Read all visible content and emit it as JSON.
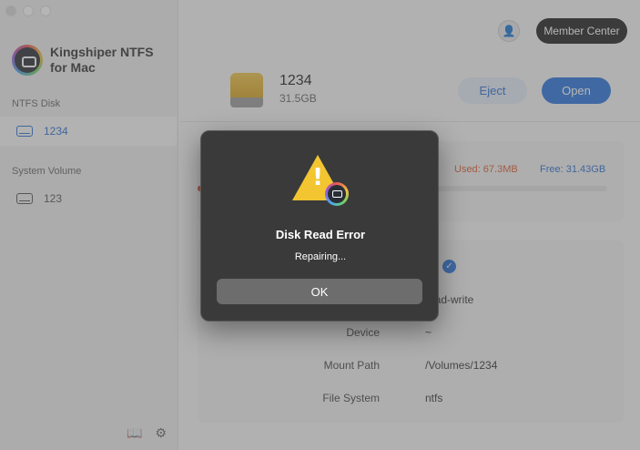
{
  "app": {
    "name": "Kingshiper NTFS for Mac"
  },
  "sidebar": {
    "ntfs_label": "NTFS Disk",
    "ntfs_items": [
      {
        "label": "1234"
      }
    ],
    "system_label": "System Volume",
    "system_items": [
      {
        "label": "123"
      }
    ]
  },
  "header": {
    "member_label": "Member Center"
  },
  "drive": {
    "name": "1234",
    "size": "31.5GB",
    "eject_label": "Eject",
    "open_label": "Open"
  },
  "usage": {
    "used": "Used:  67.3MB",
    "free": "Free:  31.43GB",
    "used_fraction": 0.002
  },
  "info": [
    {
      "label": "Device",
      "value": "~"
    },
    {
      "label": "Mount Path",
      "value": "/Volumes/1234"
    },
    {
      "label": "File System",
      "value": "ntfs"
    }
  ],
  "mode_value": "read-write",
  "dialog": {
    "title": "Disk Read Error",
    "message": "Repairing...",
    "ok_label": "OK"
  },
  "colors": {
    "accent": "#2a75de",
    "used": "#e05a2a",
    "warning": "#f2c531"
  }
}
